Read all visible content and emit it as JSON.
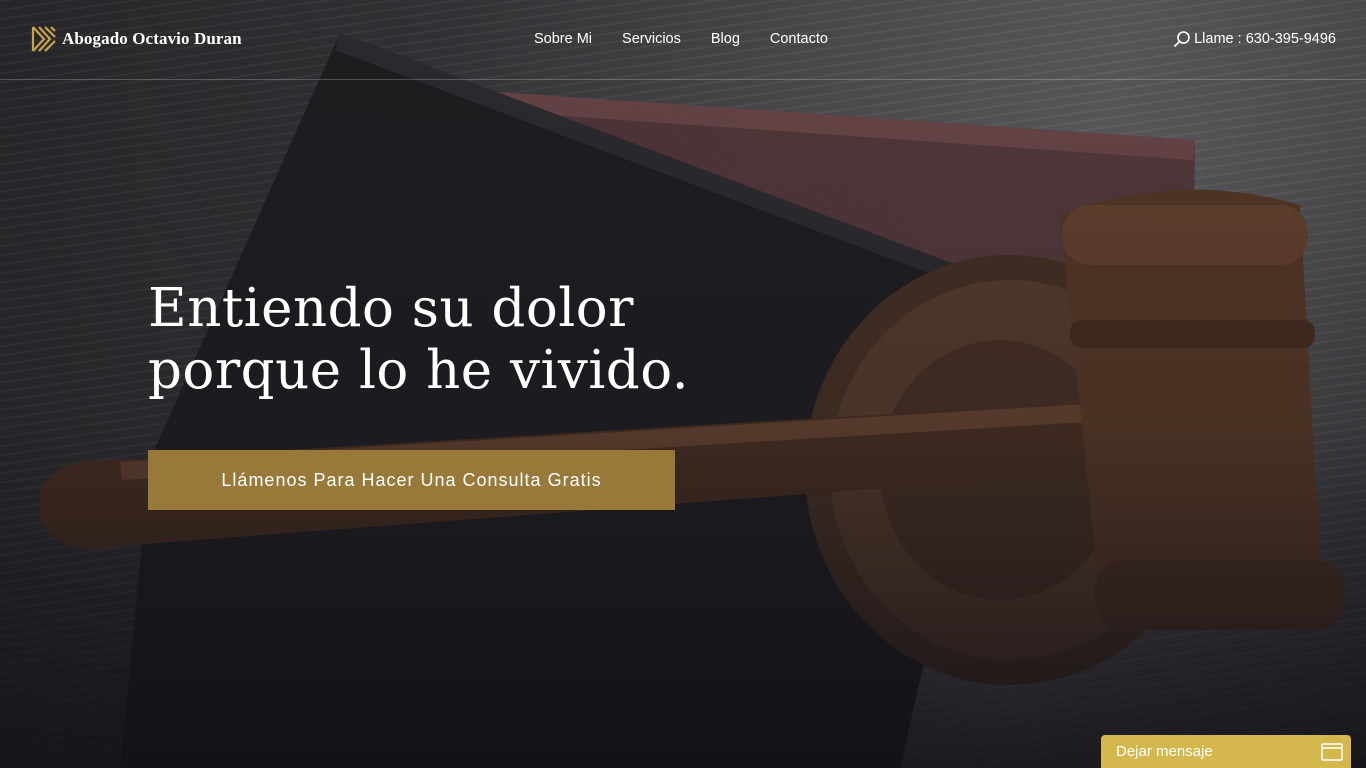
{
  "header": {
    "brand_name": "Abogado Octavio Duran",
    "logo_icon": "gold-stripes-logo-icon",
    "nav": [
      {
        "label": "Sobre Mi"
      },
      {
        "label": "Servicios"
      },
      {
        "label": "Blog"
      },
      {
        "label": "Contacto"
      }
    ],
    "call": {
      "icon": "search-icon",
      "text": "Llame : 630-395-9496"
    }
  },
  "hero": {
    "headline_line1": "Entiendo su dolor",
    "headline_line2": "porque lo he vivido.",
    "cta_label": "Llámenos Para Hacer Una Consulta Gratis",
    "background_image": "gavel-and-law-books-photo"
  },
  "message_widget": {
    "label": "Dejar mensaje",
    "icon": "window-icon"
  },
  "colors": {
    "accent_gold": "#98793a",
    "widget_yellow": "#d4b84e",
    "text": "#ffffff"
  }
}
